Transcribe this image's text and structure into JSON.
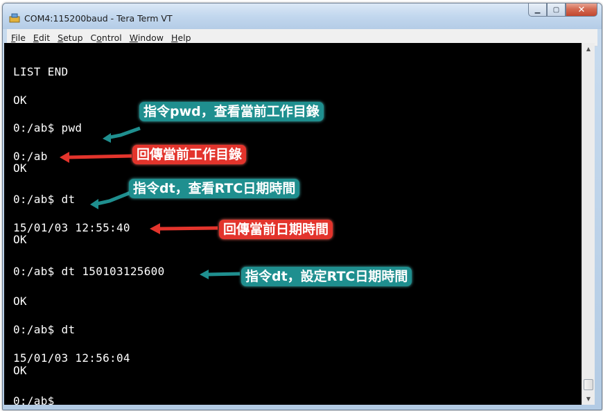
{
  "window": {
    "title": "COM4:115200baud - Tera Term VT",
    "buttons": {
      "minimize": "▁",
      "maximize": "▢",
      "close": "✕"
    }
  },
  "menu": {
    "items": [
      {
        "key": "F",
        "rest": "ile"
      },
      {
        "key": "E",
        "rest": "dit"
      },
      {
        "key": "S",
        "rest": "etup"
      },
      {
        "key": "o",
        "pre": "C",
        "rest": "ntrol"
      },
      {
        "key": "W",
        "rest": "indow"
      },
      {
        "key": "H",
        "rest": "elp"
      }
    ]
  },
  "terminal": {
    "lines": [
      "LIST END",
      "OK",
      "0:/ab$ pwd",
      "0:/ab",
      "OK",
      "0:/ab$ dt",
      "15/01/03 12:55:40",
      "OK",
      "0:/ab$ dt 150103125600",
      "OK",
      "0:/ab$ dt",
      "15/01/03 12:56:04",
      "OK",
      "0:/ab$"
    ]
  },
  "annotations": [
    {
      "text": "指令pwd，查看當前工作目錄",
      "color": "teal"
    },
    {
      "text": "回傳當前工作目錄",
      "color": "red"
    },
    {
      "text": "指令dt，查看RTC日期時間",
      "color": "teal"
    },
    {
      "text": "回傳當前日期時間",
      "color": "red"
    },
    {
      "text": "指令dt，設定RTC日期時間",
      "color": "teal"
    }
  ],
  "colors": {
    "teal": "#1f8f8f",
    "red": "#e3342c",
    "terminal_bg": "#000000",
    "terminal_fg": "#ffffff"
  },
  "icons": {
    "app": "tera-term-icon",
    "scroll_up": "scroll-up-icon",
    "scroll_down": "scroll-down-icon"
  }
}
